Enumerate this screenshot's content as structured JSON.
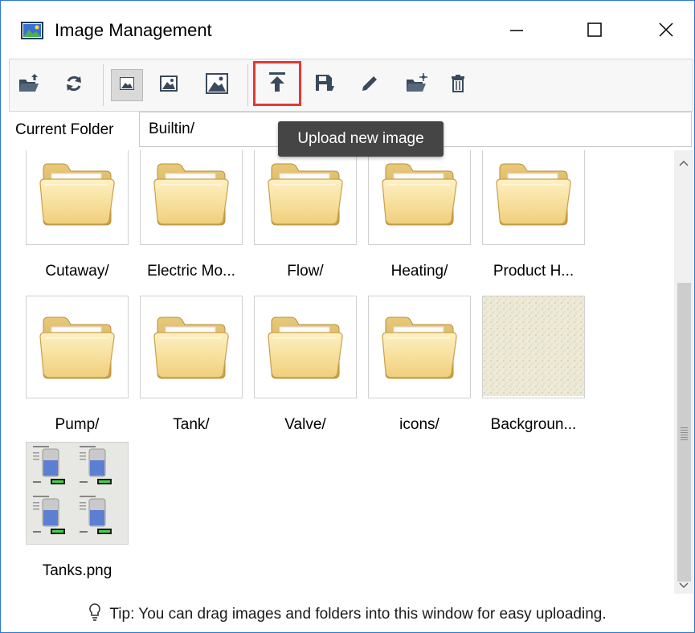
{
  "window": {
    "title": "Image Management"
  },
  "toolbar": {
    "buttons": [
      {
        "icon": "folder-open-upload-icon"
      },
      {
        "icon": "refresh-icon"
      },
      {
        "icon": "small-image-view-icon",
        "pressed": true
      },
      {
        "icon": "medium-image-view-icon"
      },
      {
        "icon": "large-image-view-icon"
      },
      {
        "icon": "upload-icon",
        "highlighted": true
      },
      {
        "icon": "save-download-icon"
      },
      {
        "icon": "edit-pencil-icon"
      },
      {
        "icon": "new-folder-icon"
      },
      {
        "icon": "trash-icon"
      }
    ]
  },
  "folder": {
    "label": "Current Folder",
    "path": "Builtin/"
  },
  "tooltip": {
    "text": "Upload new image"
  },
  "items": [
    {
      "label": "Cutaway/",
      "type": "folder"
    },
    {
      "label": "Electric Mo...",
      "type": "folder"
    },
    {
      "label": "Flow/",
      "type": "folder"
    },
    {
      "label": "Heating/",
      "type": "folder"
    },
    {
      "label": "Product H...",
      "type": "folder"
    },
    {
      "label": "Pump/",
      "type": "folder"
    },
    {
      "label": "Tank/",
      "type": "folder"
    },
    {
      "label": "Valve/",
      "type": "folder"
    },
    {
      "label": "icons/",
      "type": "folder"
    },
    {
      "label": "Backgroun...",
      "type": "texture"
    },
    {
      "label": "Tanks.png",
      "type": "image"
    }
  ],
  "tip": {
    "text": "Tip: You can drag images and folders into this window for easy uploading."
  },
  "colors": {
    "accent_border": "#2b79d4",
    "highlight": "#e53935",
    "tooltip_bg": "#454545"
  }
}
